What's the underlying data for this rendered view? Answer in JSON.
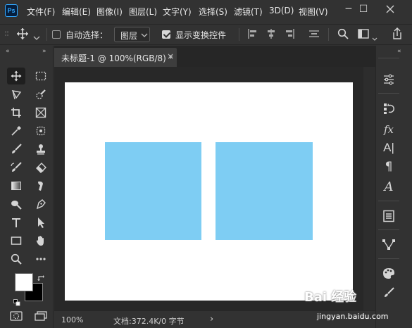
{
  "app": {
    "logo": "Ps"
  },
  "menu": {
    "items": [
      "文件(F)",
      "编辑(E)",
      "图像(I)",
      "图层(L)",
      "文字(Y)",
      "选择(S)",
      "滤镜(T)",
      "3D(D)",
      "视图(V)"
    ]
  },
  "window_controls": {
    "minimize": "─",
    "maximize": "☐"
  },
  "options": {
    "auto_select_label": "自动选择：",
    "auto_select_checked": false,
    "layer_select_value": "图层",
    "show_transform_label": "显示变换控件",
    "show_transform_checked": true
  },
  "document": {
    "tab_title": "未标题-1 @ 100%(RGB/8) *",
    "tab_close": "×",
    "canvas_color": "#ffffff",
    "shape_color": "#7ecdf3"
  },
  "status": {
    "zoom": "100%",
    "doc_info": "文档:372.4K/0 字节",
    "arrow": "›"
  },
  "colors": {
    "foreground": "#ffffff",
    "background": "#000000",
    "ui_bg": "#323232",
    "ps_blue": "#31a8ff"
  },
  "watermark": {
    "brand": "Bai 经验",
    "url": "jingyan.baidu.com"
  },
  "tools_left": [
    "move-icon",
    "marquee-icon",
    "lasso-icon",
    "quick-select-icon",
    "crop-icon",
    "frame-icon",
    "eyedropper-icon",
    "patch-icon",
    "brush-icon",
    "stamp-icon",
    "history-brush-icon",
    "eraser-icon",
    "gradient-icon",
    "smudge-icon",
    "dodge-icon",
    "pen-icon",
    "type-icon",
    "path-select-icon",
    "rectangle-icon",
    "hand-icon",
    "zoom-icon",
    "more-tools-icon"
  ],
  "tools_right": [
    "adjustments-icon",
    "history-icon",
    "fx-icon",
    "character-icon",
    "paragraph-icon",
    "glyphs-icon",
    "properties-icon",
    "paths-icon",
    "swatches-icon",
    "brushes-icon"
  ]
}
